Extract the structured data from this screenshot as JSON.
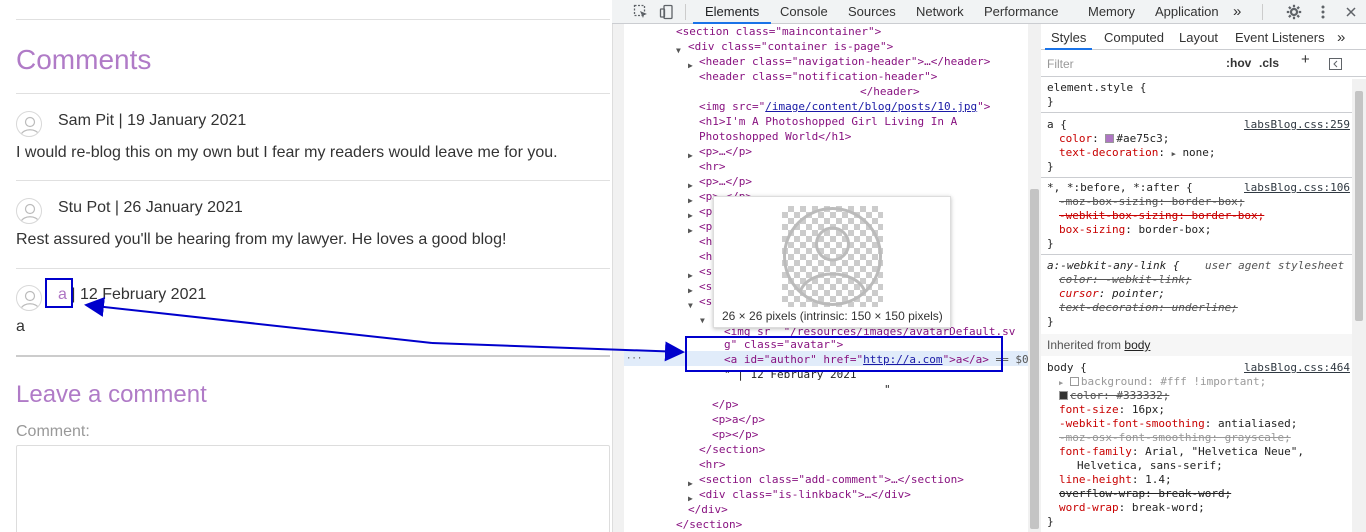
{
  "page": {
    "comments_heading": "Comments",
    "comments": [
      {
        "author": "Sam Pit",
        "date": "19 January 2021",
        "body": "I would re-blog this on my own but I fear my readers would leave me for you."
      },
      {
        "author": "Stu Pot",
        "date": "26 January 2021",
        "body": "Rest assured you'll be hearing from my lawyer. He loves a good blog!"
      }
    ],
    "third_comment": {
      "author_link": "a",
      "separator": "|",
      "date": "12 February 2021",
      "body": "a"
    },
    "leave_heading": "Leave a comment",
    "comment_label": "Comment:"
  },
  "devtools": {
    "tabs": [
      "Elements",
      "Console",
      "Sources",
      "Network",
      "Performance",
      "Memory",
      "Application"
    ],
    "more_tabs": "»",
    "dom": {
      "section_open": "<section class=\"maincontainer\">",
      "div_container": "<div class=\"container is-page\">",
      "header_nav": "<header class=\"navigation-header\">…</header>",
      "header_notif": "<header class=\"notification-header\">",
      "header_close": "</header>",
      "img_src_prefix": "<img src=\"",
      "img_src_link": "/image/content/blog/posts/10.jpg",
      "img_src_suffix": "\">",
      "h1_line1": "<h1>I'm A Photoshopped Girl Living In A",
      "h1_line2": "Photoshopped World</h1>",
      "p_collapsed": "<p>…</p>",
      "hr": "<hr>",
      "p_partial": "<p>…</p>",
      "p_cut": "<p",
      "h_cut": "<h",
      "se_cut": "<se",
      "img_avatar_path": "<img sr  \"/resources/images/avatarDefault.sv",
      "img_avatar_end": "g\" class=\"avatar\">",
      "a_line_open": "<a id=\"author\" href=\"",
      "a_href": "http://a.com",
      "a_line_close": "\">a</a>",
      "a_eq": " == $0",
      "text_node": "\" | 12 February 2021",
      "text_node_end": "\"",
      "p_close": "</p>",
      "p_a": "<p>a</p>",
      "p_empty": "<p></p>",
      "section_close": "</section>",
      "hr2": "<hr>",
      "add_comment": "<section class=\"add-comment\">…</section>",
      "linkback": "<div class=\"is-linkback\">…</div>",
      "div_close": "</div>",
      "section_close2": "</section>",
      "ellipsis": "···"
    },
    "tooltip": "26 × 26 pixels (intrinsic: 150 × 150 pixels)",
    "styles": {
      "tabs": [
        "Styles",
        "Computed",
        "Layout",
        "Event Listeners"
      ],
      "more": "»",
      "filter_placeholder": "Filter",
      "hov": ":hov",
      "cls": ".cls",
      "plus": "+",
      "element_style": "element.style {",
      "close_brace": "}",
      "rule_a": {
        "selector": "a {",
        "source": "labsBlog.css:259",
        "color_name": "color",
        "color_value": "#ae75c3;",
        "color_hex": "#ae75c3",
        "td_name": "text-decoration",
        "td_value": "none;"
      },
      "rule_star": {
        "selector": "*, *:before, *:after {",
        "source": "labsBlog.css:106",
        "p1": "-moz-box-sizing: border-box;",
        "p2": "-webkit-box-sizing: border-box;",
        "p3_name": "box-sizing",
        "p3_value": "border-box;"
      },
      "rule_wal": {
        "selector": "a:-webkit-any-link {",
        "source": "user agent stylesheet",
        "p1": "color: -webkit-link;",
        "p2_name": "cursor",
        "p2_value": "pointer;",
        "p3": "text-decoration: underline;"
      },
      "inherited_prefix": "Inherited from",
      "inherited_from": "body",
      "rule_body": {
        "selector": "body {",
        "source": "labsBlog.css:464",
        "bg": "background: #fff !important;",
        "color": "color: #333332;",
        "color_hex": "#333332",
        "fs_name": "font-size",
        "fs_value": "16px;",
        "wfs_name": "-webkit-font-smoothing",
        "wfs_value": "antialiased;",
        "mfs": "-moz-osx-font-smoothing: grayscale;",
        "ff_name": "font-family",
        "ff_value": "Arial, \"Helvetica Neue\",",
        "ff_value2": "Helvetica, sans-serif;",
        "lh_name": "line-height",
        "lh_value": "1.4;",
        "ow": "overflow-wrap: break-word;",
        "ww_name": "word-wrap",
        "ww_value": "break-word;"
      }
    }
  },
  "colors": {
    "accent": "#b07bc7",
    "link": "#ae75c3",
    "annotation": "#0000cc",
    "devtools_selected": "#e1ecfa"
  }
}
